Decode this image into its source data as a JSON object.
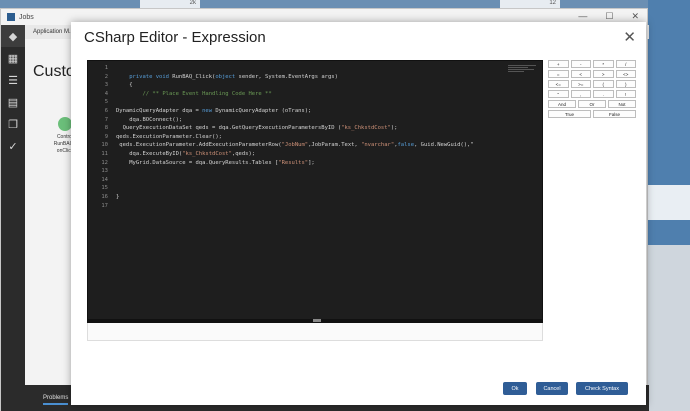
{
  "app": {
    "window_title": "Jobs",
    "nav_label": "Application M...",
    "heading": "Custo",
    "component_lines": [
      "Control",
      "RunBAQ_",
      "onClick"
    ],
    "bottom_tab": "Problems",
    "bg_top_left": "2k",
    "bg_top_right": "12"
  },
  "modal": {
    "title": "CSharp Editor - Expression",
    "close": "✕"
  },
  "editor": {
    "line_numbers": [
      "1",
      "2",
      "3",
      "4",
      "5",
      "6",
      "7",
      "8",
      "9",
      "10",
      "11",
      "12",
      "13",
      "14",
      "15",
      "16",
      "17"
    ],
    "lines": [
      {
        "segments": [
          {
            "t": "",
            "c": ""
          }
        ]
      },
      {
        "segments": [
          {
            "t": "    ",
            "c": ""
          },
          {
            "t": "private void",
            "c": "kw"
          },
          {
            "t": " RunBAQ_Click(",
            "c": ""
          },
          {
            "t": "object",
            "c": "kw"
          },
          {
            "t": " sender, System.EventArgs args)",
            "c": ""
          }
        ]
      },
      {
        "segments": [
          {
            "t": "    {",
            "c": ""
          }
        ]
      },
      {
        "segments": [
          {
            "t": "        ",
            "c": ""
          },
          {
            "t": "// ** Place Event Handling Code Here **",
            "c": "cm"
          }
        ]
      },
      {
        "segments": [
          {
            "t": "",
            "c": ""
          }
        ]
      },
      {
        "segments": [
          {
            "t": "DynamicQueryAdapter dqa = ",
            "c": ""
          },
          {
            "t": "new",
            "c": "kw"
          },
          {
            "t": " DynamicQueryAdapter (oTrans);",
            "c": ""
          }
        ]
      },
      {
        "segments": [
          {
            "t": "    dqa.BOConnect();",
            "c": ""
          }
        ]
      },
      {
        "segments": [
          {
            "t": "  QueryExecutionDataSet qeds = dqa.GetQueryExecutionParametersByID (",
            "c": ""
          },
          {
            "t": "\"ks_ChkstdCost\"",
            "c": "st"
          },
          {
            "t": ");",
            "c": ""
          }
        ]
      },
      {
        "segments": [
          {
            "t": "qeds.ExecutionParameter.Clear();",
            "c": ""
          }
        ]
      },
      {
        "segments": [
          {
            "t": " qeds.ExecutionParameter.AddExecutionParameterRow(",
            "c": ""
          },
          {
            "t": "\"JobNum\"",
            "c": "st"
          },
          {
            "t": ",JobParam.Text, ",
            "c": ""
          },
          {
            "t": "\"nvarchar\"",
            "c": "st"
          },
          {
            "t": ",",
            "c": ""
          },
          {
            "t": "false",
            "c": "kw"
          },
          {
            "t": ", Guid.NewGuid(),\"",
            "c": ""
          }
        ]
      },
      {
        "segments": [
          {
            "t": "    dqa.ExecuteByID(",
            "c": ""
          },
          {
            "t": "\"ks_ChkstdCost\"",
            "c": "st"
          },
          {
            "t": ",qeds);",
            "c": ""
          }
        ]
      },
      {
        "segments": [
          {
            "t": "    MyGrid.DataSource = dqa.QueryResults.Tables [",
            "c": ""
          },
          {
            "t": "\"Results\"",
            "c": "st"
          },
          {
            "t": "];",
            "c": ""
          }
        ]
      },
      {
        "segments": [
          {
            "t": "",
            "c": ""
          }
        ]
      },
      {
        "segments": [
          {
            "t": "",
            "c": ""
          }
        ]
      },
      {
        "segments": [
          {
            "t": "",
            "c": ""
          }
        ]
      },
      {
        "segments": [
          {
            "t": "}",
            "c": ""
          }
        ]
      },
      {
        "segments": [
          {
            "t": "",
            "c": ""
          }
        ]
      }
    ]
  },
  "keypad": {
    "rows": [
      [
        "+",
        "-",
        "*",
        "/"
      ],
      [
        "=",
        "<",
        ">",
        "<>"
      ],
      [
        "<=",
        ">=",
        "(",
        ")"
      ],
      [
        "\"",
        ",",
        ".",
        "!"
      ],
      [
        "And",
        "Or",
        "Not"
      ],
      [
        "True",
        "False"
      ]
    ]
  },
  "buttons": {
    "ok": "Ok",
    "cancel": "Cancel",
    "check_syntax": "Check Syntax"
  }
}
